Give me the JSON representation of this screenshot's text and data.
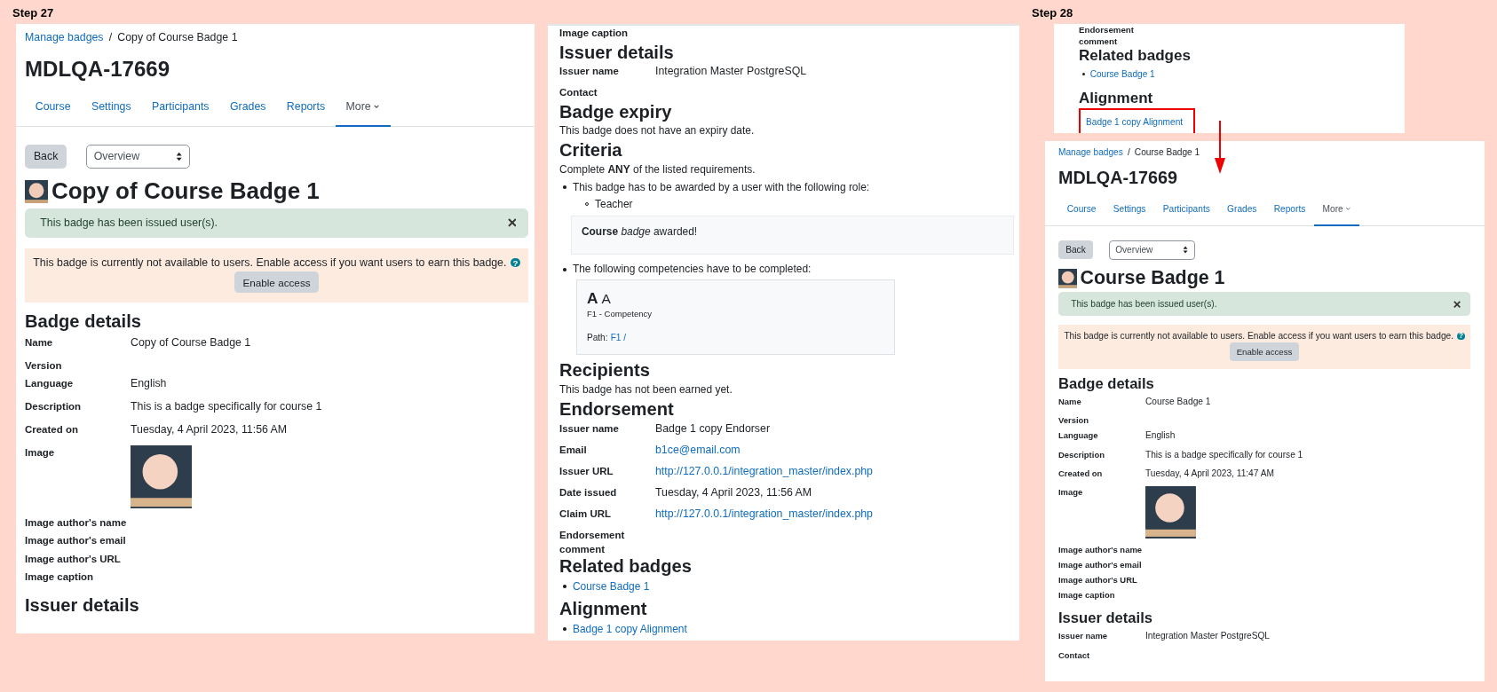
{
  "step_labels": [
    "Step 27",
    "Step 28"
  ],
  "panels": [
    {
      "blocks": [
        {
          "kind": "breadcrumb",
          "link": "Manage badges",
          "separator": "/",
          "current": "Copy of Course Badge 1"
        },
        {
          "kind": "page_title",
          "text": "MDLQA-17669"
        },
        {
          "kind": "nav",
          "tabs": [
            {
              "label": "Course",
              "selected": false,
              "dropdown": false
            },
            {
              "label": "Settings",
              "selected": false,
              "dropdown": false
            },
            {
              "label": "Participants",
              "selected": false,
              "dropdown": false
            },
            {
              "label": "Grades",
              "selected": false,
              "dropdown": false
            },
            {
              "label": "Reports",
              "selected": false,
              "dropdown": false
            },
            {
              "label": "More",
              "selected": true,
              "dropdown": true
            }
          ]
        },
        {
          "kind": "controls",
          "button": "Back",
          "select": "Overview"
        },
        {
          "kind": "badge_title",
          "text": "Copy of Course Badge 1"
        },
        {
          "kind": "success_alert",
          "text": "This badge has been issued user(s)."
        },
        {
          "kind": "warning_alert",
          "text": "This badge is currently not available to users. Enable access if you want users to earn this badge.",
          "help": "?",
          "button": "Enable access"
        },
        {
          "kind": "heading",
          "text": "Badge details"
        },
        {
          "kind": "fields",
          "rows": [
            {
              "label": "Name",
              "kind": "text",
              "value": "Copy of Course Badge 1"
            },
            {
              "label": "Version",
              "kind": "empty"
            },
            {
              "label": "Language",
              "kind": "text",
              "value": "English"
            },
            {
              "label": "Description",
              "kind": "text",
              "value": "This is a badge specifically for course 1"
            },
            {
              "label": "Created on",
              "kind": "text",
              "value": "Tuesday, 4 April 2023, 11:56 AM"
            },
            {
              "label": "Image",
              "kind": "image"
            },
            {
              "label": "Image author's name",
              "kind": "empty"
            },
            {
              "label": "Image author's email",
              "kind": "empty"
            },
            {
              "label": "Image author's URL",
              "kind": "empty"
            },
            {
              "label": "Image caption",
              "kind": "empty"
            }
          ]
        },
        {
          "kind": "heading",
          "text": "Issuer details"
        }
      ]
    },
    {
      "blocks": [
        {
          "kind": "fields",
          "rows": [
            {
              "label": "Image caption",
              "kind": "empty"
            }
          ]
        },
        {
          "kind": "heading",
          "text": "Issuer details"
        },
        {
          "kind": "fields",
          "rows": [
            {
              "label": "Issuer name",
              "kind": "text",
              "value": "Integration Master PostgreSQL"
            },
            {
              "label": "Contact",
              "kind": "empty"
            }
          ]
        },
        {
          "kind": "heading",
          "text": "Badge expiry"
        },
        {
          "kind": "paragraph",
          "text": "This badge does not have an expiry date."
        },
        {
          "kind": "heading",
          "text": "Criteria"
        },
        {
          "kind": "paragraph",
          "text": "Complete **ANY** of the listed requirements."
        },
        {
          "kind": "criteria",
          "items": [
            {
              "text": "This badge has to be awarded by a user with the following role:",
              "subitems": [
                "Teacher"
              ],
              "note": "**Course** *badge* awarded!"
            },
            {
              "text": "The following competencies have to be completed:",
              "competency": {
                "shortname": "A",
                "idnumber": "A",
                "framework": "F1 - Competency",
                "path_label": "Path:",
                "path_link": "F1 /"
              }
            }
          ]
        },
        {
          "kind": "heading",
          "text": "Recipients"
        },
        {
          "kind": "paragraph",
          "text": "This badge has not been earned yet."
        },
        {
          "kind": "heading",
          "text": "Endorsement"
        },
        {
          "kind": "fields",
          "rows": [
            {
              "label": "Issuer name",
              "kind": "text",
              "value": "Badge 1 copy Endorser"
            },
            {
              "label": "Email",
              "kind": "link",
              "value": "b1ce@email.com"
            },
            {
              "label": "Issuer URL",
              "kind": "link",
              "value": "http://127.0.0.1/integration_master/index.php"
            },
            {
              "label": "Date issued",
              "kind": "text",
              "value": "Tuesday, 4 April 2023, 11:56 AM"
            },
            {
              "label": "Claim URL",
              "kind": "link",
              "value": "http://127.0.0.1/integration_master/index.php"
            },
            {
              "label": "Endorsement comment",
              "kind": "empty"
            }
          ]
        },
        {
          "kind": "heading",
          "text": "Related badges"
        },
        {
          "kind": "links",
          "items": [
            {
              "label": "Course Badge 1",
              "highlighted": false
            }
          ]
        },
        {
          "kind": "heading",
          "text": "Alignment"
        },
        {
          "kind": "links",
          "items": [
            {
              "label": "Badge 1 copy Alignment",
              "highlighted": false
            }
          ]
        }
      ]
    },
    {
      "blocks": [
        {
          "kind": "fields",
          "rows": [
            {
              "label": "Endorsement comment",
              "kind": "empty"
            }
          ]
        },
        {
          "kind": "heading",
          "text": "Related badges"
        },
        {
          "kind": "links",
          "items": [
            {
              "label": "Course Badge 1",
              "highlighted": false
            }
          ]
        },
        {
          "kind": "heading",
          "text": "Alignment"
        },
        {
          "kind": "links",
          "items": [
            {
              "label": "Badge 1 copy Alignment",
              "highlighted": true
            }
          ]
        }
      ]
    },
    {
      "blocks": [
        {
          "kind": "breadcrumb",
          "link": "Manage badges",
          "separator": "/",
          "current": "Course Badge 1"
        },
        {
          "kind": "page_title",
          "text": "MDLQA-17669"
        },
        {
          "kind": "nav",
          "tabs": [
            {
              "label": "Course",
              "selected": false,
              "dropdown": false
            },
            {
              "label": "Settings",
              "selected": false,
              "dropdown": false
            },
            {
              "label": "Participants",
              "selected": false,
              "dropdown": false
            },
            {
              "label": "Grades",
              "selected": false,
              "dropdown": false
            },
            {
              "label": "Reports",
              "selected": false,
              "dropdown": false
            },
            {
              "label": "More",
              "selected": true,
              "dropdown": true
            }
          ]
        },
        {
          "kind": "controls",
          "button": "Back",
          "select": "Overview"
        },
        {
          "kind": "badge_title",
          "text": "Course Badge 1"
        },
        {
          "kind": "success_alert",
          "text": "This badge has been issued user(s)."
        },
        {
          "kind": "warning_alert",
          "text": "This badge is currently not available to users. Enable access if you want users to earn this badge.",
          "help": "?",
          "button": "Enable access"
        },
        {
          "kind": "heading",
          "text": "Badge details"
        },
        {
          "kind": "fields",
          "rows": [
            {
              "label": "Name",
              "kind": "text",
              "value": "Course Badge 1"
            },
            {
              "label": "Version",
              "kind": "empty"
            },
            {
              "label": "Language",
              "kind": "text",
              "value": "English"
            },
            {
              "label": "Description",
              "kind": "text",
              "value": "This is a badge specifically for course 1"
            },
            {
              "label": "Created on",
              "kind": "text",
              "value": "Tuesday, 4 April 2023, 11:47 AM"
            },
            {
              "label": "Image",
              "kind": "image"
            },
            {
              "label": "Image author's name",
              "kind": "empty"
            },
            {
              "label": "Image author's email",
              "kind": "empty"
            },
            {
              "label": "Image author's URL",
              "kind": "empty"
            },
            {
              "label": "Image caption",
              "kind": "empty"
            }
          ]
        },
        {
          "kind": "heading",
          "text": "Issuer details"
        },
        {
          "kind": "fields",
          "rows": [
            {
              "label": "Issuer name",
              "kind": "text",
              "value": "Integration Master PostgreSQL"
            },
            {
              "label": "Contact",
              "kind": "empty"
            }
          ]
        }
      ]
    }
  ]
}
